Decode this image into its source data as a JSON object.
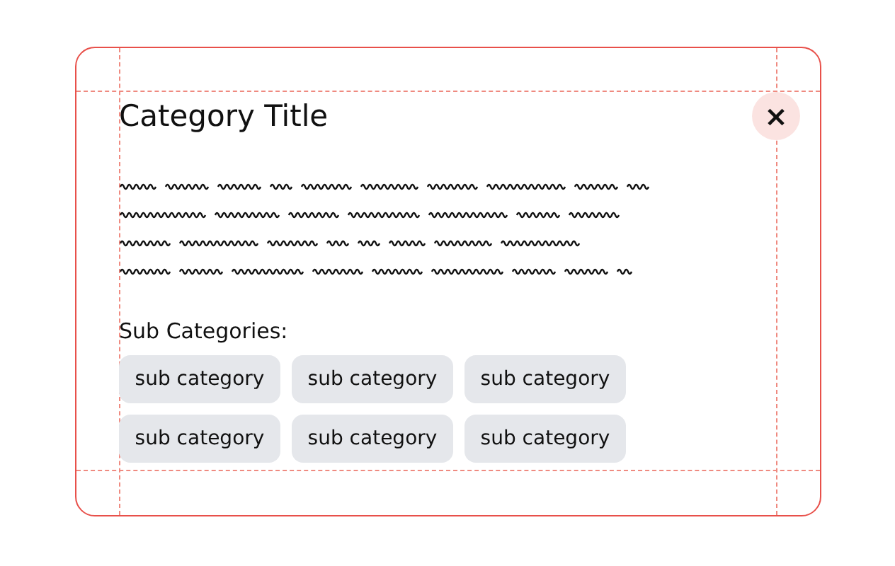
{
  "dialog": {
    "title": "Category Title",
    "close_button": "×",
    "subcategories_label": "Sub Categories:",
    "subcategories": [
      "sub category",
      "sub category",
      "sub category",
      "sub category",
      "sub category",
      "sub category"
    ]
  }
}
